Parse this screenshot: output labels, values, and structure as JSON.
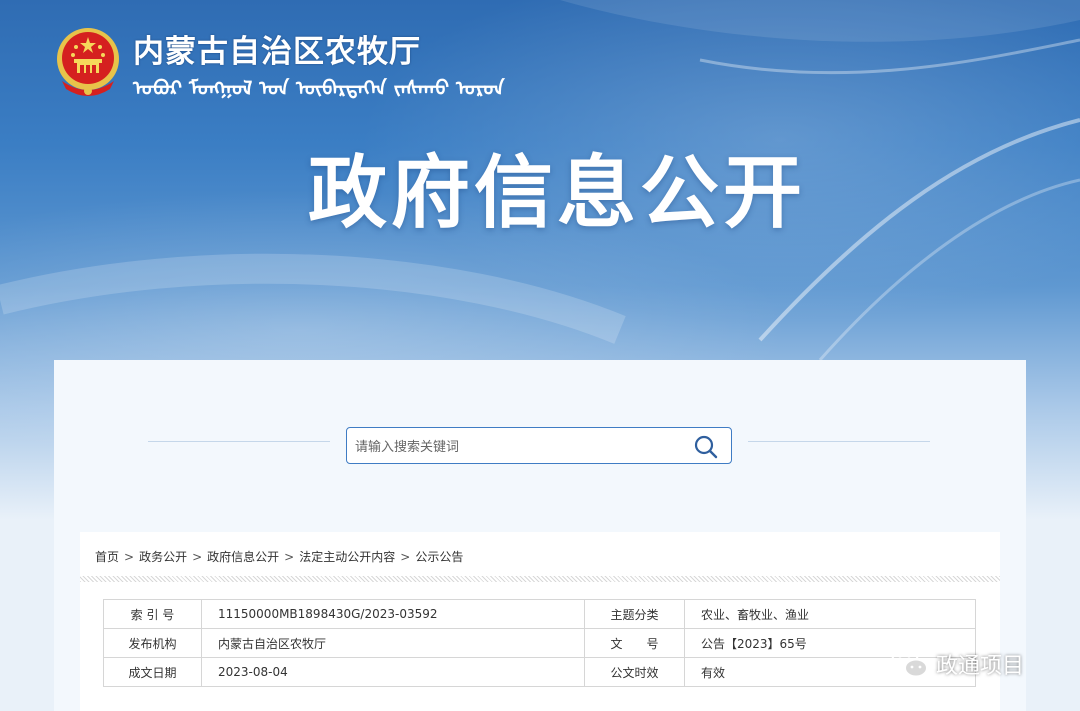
{
  "header": {
    "agency_name": "内蒙古自治区农牧厅",
    "mongolian_name": "ᠣᠪᠣᠷ ᠮᠣᠩᠭᠣᠯ ᠤᠨ ᠥᠪᠡᠷᠲᠡᠭᠡᠨ ᠵᠠᠰᠠᠬᠤ ᠣᠷᠣᠨ",
    "banner_title": "政府信息公开"
  },
  "search": {
    "placeholder": "请输入搜索关键词"
  },
  "breadcrumb": [
    "首页",
    "政务公开",
    "政府信息公开",
    "法定主动公开内容",
    "公示公告"
  ],
  "breadcrumb_separator": ">",
  "meta_table": {
    "rows": [
      {
        "label1": "索 引 号",
        "value1": "11150000MB1898430G/2023-03592",
        "label2": "主题分类",
        "value2": "农业、畜牧业、渔业"
      },
      {
        "label1": "发布机构",
        "value1": "内蒙古自治区农牧厅",
        "label2": "文　　号",
        "value2": "公告【2023】65号"
      },
      {
        "label1": "成文日期",
        "value1": "2023-08-04",
        "label2": "公文时效",
        "value2": "有效"
      }
    ]
  },
  "watermark": {
    "text": "政通项目"
  },
  "colors": {
    "accent": "#3f7cc4",
    "banner_top": "#2f6cb3",
    "panel": "#f3f8fd"
  },
  "icons": {
    "emblem": "national-emblem-icon",
    "search": "search-icon",
    "wechat": "wechat-icon"
  }
}
